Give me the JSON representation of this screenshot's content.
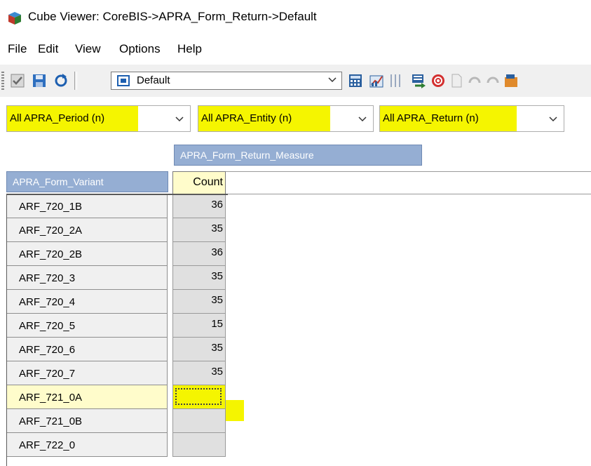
{
  "window": {
    "title": "Cube Viewer: CoreBIS->APRA_Form_Return->Default"
  },
  "menu": {
    "file": "File",
    "edit": "Edit",
    "view": "View",
    "options": "Options",
    "help": "Help"
  },
  "toolbar": {
    "view_selector": {
      "value": "Default"
    }
  },
  "filters": [
    {
      "label": "All APRA_Period (n)"
    },
    {
      "label": "All APRA_Entity (n)"
    },
    {
      "label": "All APRA_Return (n)"
    }
  ],
  "grid": {
    "column_dimension": "APRA_Form_Return_Measure",
    "row_dimension": "APRA_Form_Variant",
    "column_header": "Count",
    "rows": [
      {
        "label": "ARF_720_1B",
        "value": "36"
      },
      {
        "label": "ARF_720_2A",
        "value": "35"
      },
      {
        "label": "ARF_720_2B",
        "value": "36"
      },
      {
        "label": "ARF_720_3",
        "value": "35"
      },
      {
        "label": "ARF_720_4",
        "value": "35"
      },
      {
        "label": "ARF_720_5",
        "value": "15"
      },
      {
        "label": "ARF_720_6",
        "value": "35"
      },
      {
        "label": "ARF_720_7",
        "value": "35"
      },
      {
        "label": "ARF_721_0A",
        "value": ""
      },
      {
        "label": "ARF_721_0B",
        "value": ""
      },
      {
        "label": "ARF_722_0",
        "value": ""
      }
    ]
  },
  "colors": {
    "header_blue": "#95aed3",
    "highlight_yellow": "#f5f500",
    "selected_cream": "#fffccb"
  }
}
